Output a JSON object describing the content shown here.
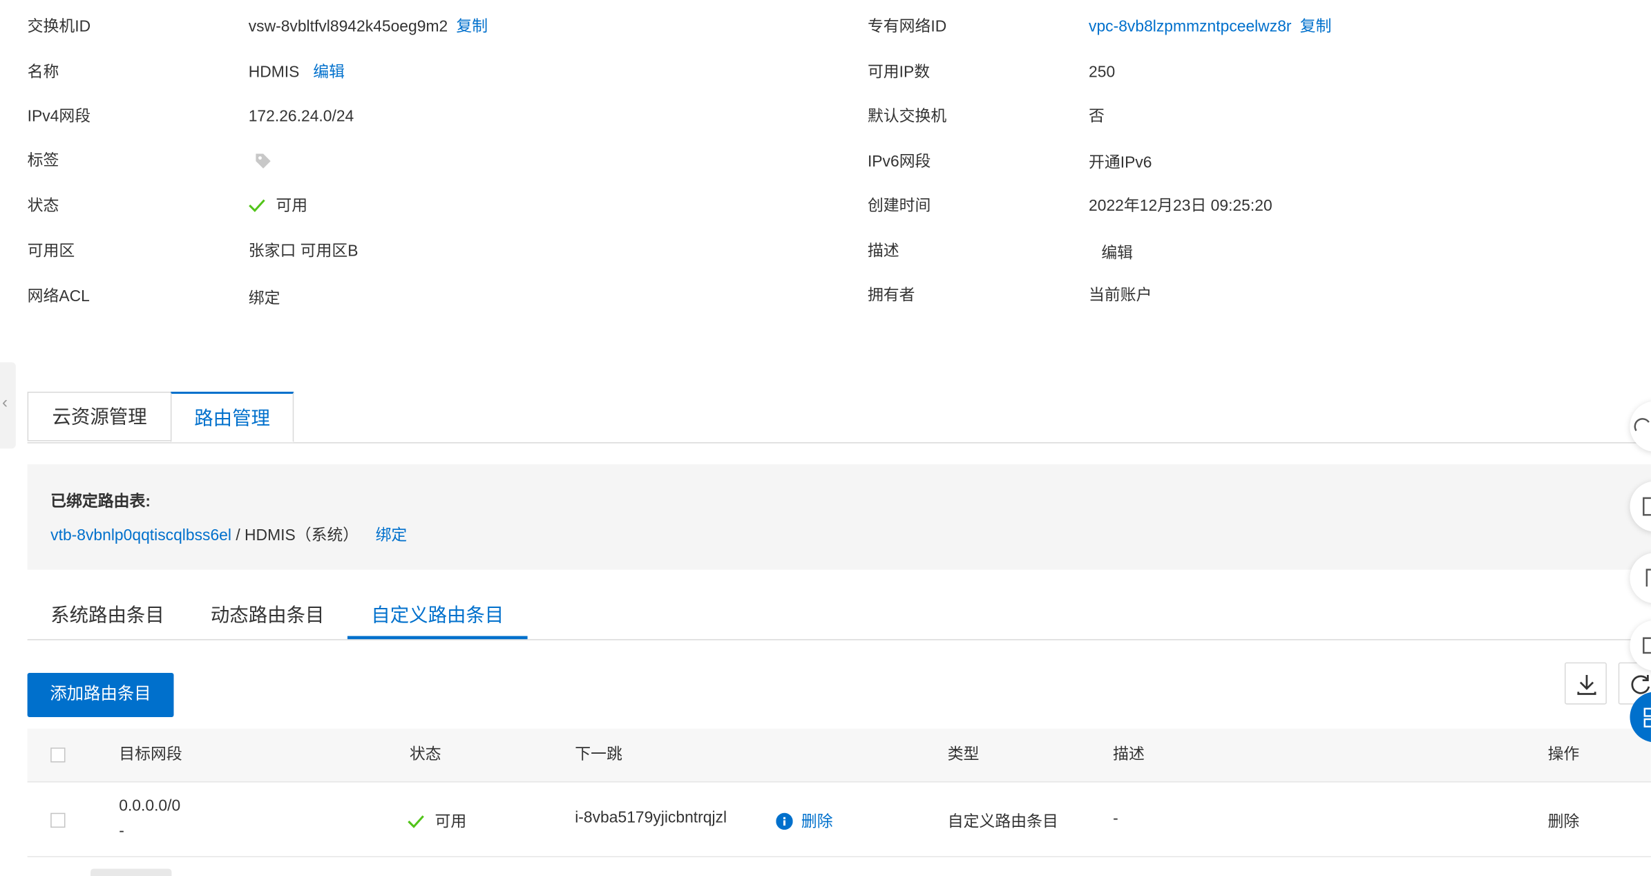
{
  "info": {
    "left": [
      {
        "label": "交换机ID",
        "value": "vsw-8vbltfvl8942k45oeg9m2",
        "link": "复制"
      },
      {
        "label": "名称",
        "value": "HDMIS",
        "link": "编辑"
      },
      {
        "label": "IPv4网段",
        "value": "172.26.24.0/24"
      },
      {
        "label": "标签",
        "icon": "tag-icon"
      },
      {
        "label": "状态",
        "value": "可用",
        "icon": "check-icon"
      },
      {
        "label": "可用区",
        "value": "张家口 可用区B"
      },
      {
        "label": "网络ACL",
        "link": "绑定"
      }
    ],
    "right": [
      {
        "label": "专有网络ID",
        "value_link": "vpc-8vb8lzpmmzntpceelwz8r",
        "link": "复制"
      },
      {
        "label": "可用IP数",
        "value": "250"
      },
      {
        "label": "默认交换机",
        "value": "否"
      },
      {
        "label": "IPv6网段",
        "link": "开通IPv6"
      },
      {
        "label": "创建时间",
        "value": "2022年12月23日 09:25:20"
      },
      {
        "label": "描述",
        "link": "编辑"
      },
      {
        "label": "拥有者",
        "value": "当前账户"
      }
    ]
  },
  "tabs": [
    {
      "label": "云资源管理",
      "active": false
    },
    {
      "label": "路由管理",
      "active": true
    }
  ],
  "bound_table": {
    "title": "已绑定路由表:",
    "route_table_id": "vtb-8vbnlp0qqtiscqlbss6el",
    "route_table_name": " / HDMIS（系统）",
    "bind_link": "绑定"
  },
  "subtabs": [
    {
      "label": "系统路由条目",
      "active": false
    },
    {
      "label": "动态路由条目",
      "active": false
    },
    {
      "label": "自定义路由条目",
      "active": true
    }
  ],
  "toolbar": {
    "add_button": "添加路由条目"
  },
  "table": {
    "columns": [
      "目标网段",
      "状态",
      "下一跳",
      "类型",
      "描述",
      "操作"
    ],
    "rows": [
      {
        "destination": "0.0.0.0/0",
        "destination_sub": "-",
        "status": "可用",
        "next_hop": "i-8vba5179yjicbntrqjzl",
        "next_hop_action": "删除",
        "type": "自定义路由条目",
        "description": "-",
        "action": "删除"
      }
    ]
  },
  "colors": {
    "accent": "#0070cc",
    "success": "#52c41a",
    "panel_bg": "#f5f5f5"
  }
}
